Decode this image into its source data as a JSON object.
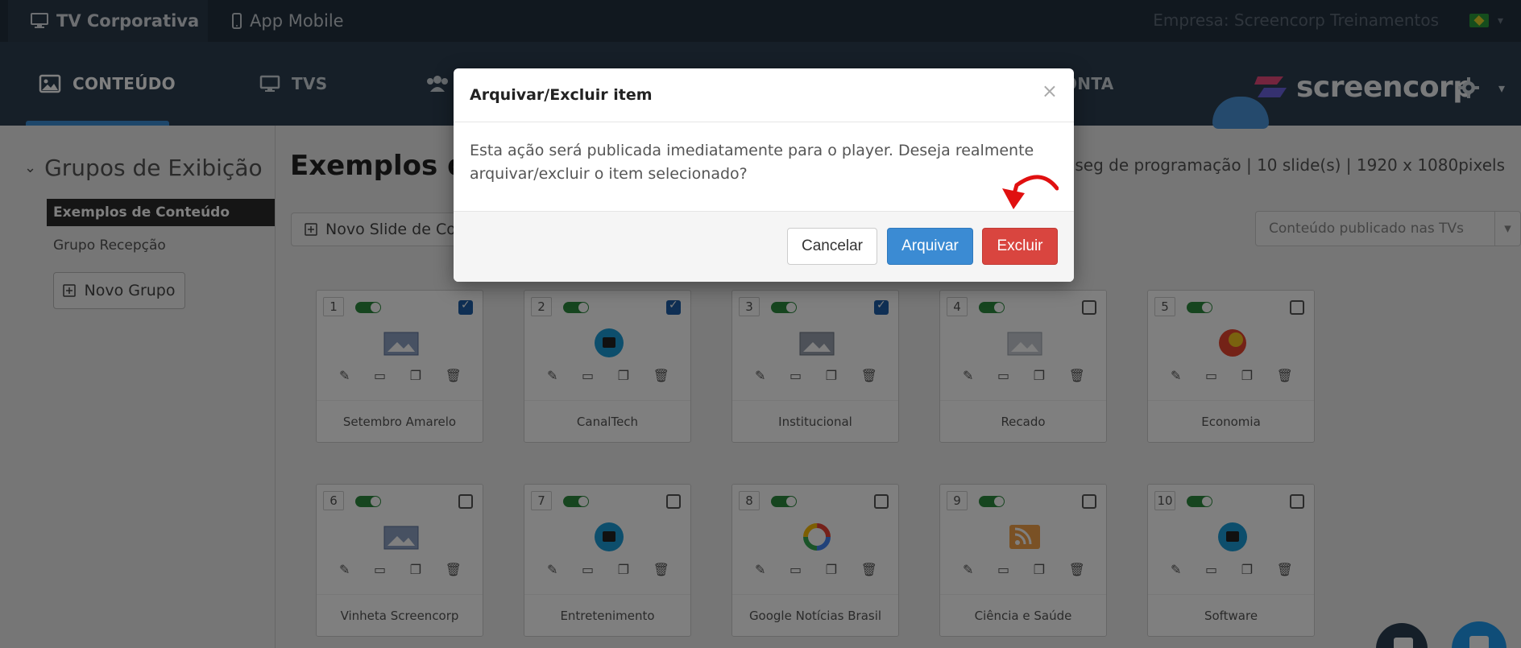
{
  "topbar": {
    "tab_tv": "TV Corporativa",
    "tab_app": "App Mobile",
    "company": "Empresa: Screencorp Treinamentos"
  },
  "nav": {
    "items": [
      {
        "label": "CONTEÚDO",
        "icon": "image-icon"
      },
      {
        "label": "TVS",
        "icon": "monitor-icon"
      },
      {
        "label": "",
        "icon": "users-icon"
      },
      {
        "label": "ONTA",
        "icon": ""
      }
    ],
    "brand": "screencorp"
  },
  "sidebar": {
    "title": "Grupos de Exibição",
    "groups": [
      "Exemplos de Conteúdo",
      "Grupo Recepção"
    ],
    "new_group": "Novo Grupo"
  },
  "main": {
    "title": "Exemplos de",
    "info": "min 06seg de programação | 10 slide(s) | 1920 x 1080pixels",
    "new_slide": "Novo Slide de Con",
    "published": "Conteúdo publicado nas TVs"
  },
  "cards": [
    {
      "num": "1",
      "label": "Setembro Amarelo",
      "checked": true,
      "thumb": "image-placeholder-icon"
    },
    {
      "num": "2",
      "label": "CanalTech",
      "checked": true,
      "thumb": "canaltech-logo-icon"
    },
    {
      "num": "3",
      "label": "Institucional",
      "checked": true,
      "thumb": "image-placeholder-icon"
    },
    {
      "num": "4",
      "label": "Recado",
      "checked": false,
      "thumb": "image-placeholder-icon"
    },
    {
      "num": "5",
      "label": "Economia",
      "checked": false,
      "thumb": "economy-logo-icon"
    },
    {
      "num": "6",
      "label": "Vinheta Screencorp",
      "checked": false,
      "thumb": "image-placeholder-icon"
    },
    {
      "num": "7",
      "label": "Entretenimento",
      "checked": false,
      "thumb": "canaltech-logo-icon"
    },
    {
      "num": "8",
      "label": "Google Notícias Brasil",
      "checked": false,
      "thumb": "google-logo-icon"
    },
    {
      "num": "9",
      "label": "Ciência e Saúde",
      "checked": false,
      "thumb": "rss-icon"
    },
    {
      "num": "10",
      "label": "Software",
      "checked": false,
      "thumb": "canaltech-logo-icon"
    }
  ],
  "modal": {
    "title": "Arquivar/Excluir item",
    "close": "×",
    "body": "Esta ação será publicada imediatamente para o player. Deseja realmente arquivar/excluir o item selecionado?",
    "cancel": "Cancelar",
    "archive": "Arquivar",
    "delete": "Excluir"
  },
  "colors": {
    "nav_bg": "#2c3e50",
    "accent_blue": "#3b8bd3",
    "danger": "#d9453f",
    "toggle_on": "#2d8a3e"
  }
}
